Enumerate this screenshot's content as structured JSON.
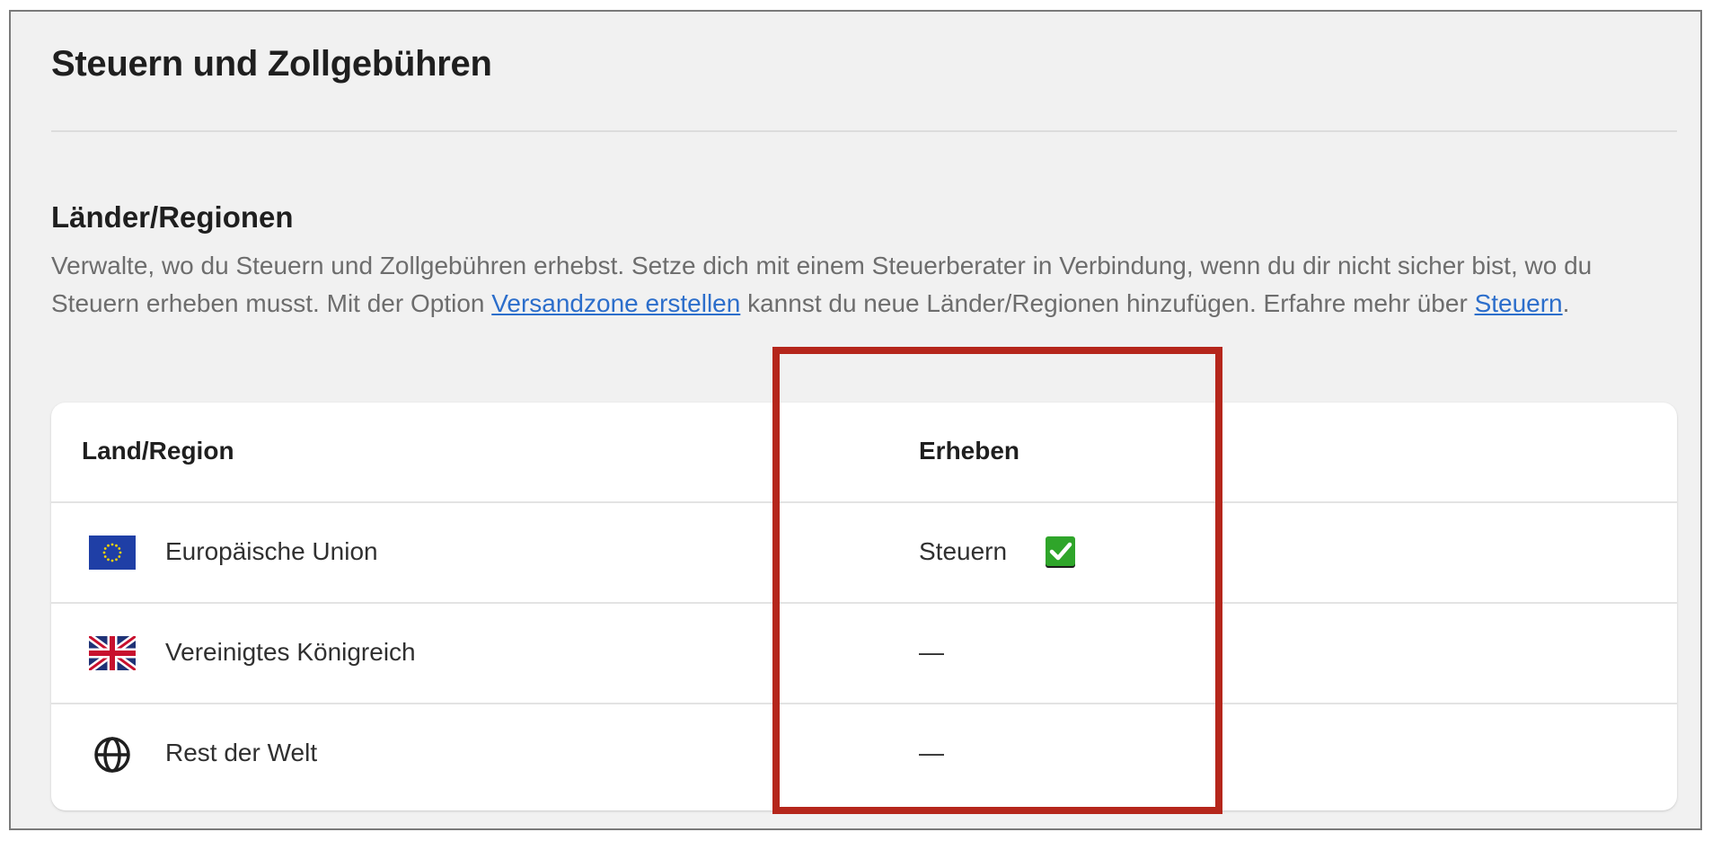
{
  "page": {
    "title": "Steuern und Zollgebühren"
  },
  "section": {
    "title": "Länder/Regionen",
    "description_part1": "Verwalte, wo du Steuern und Zollgebühren erhebst. Setze dich mit einem Steuerberater in Verbindung, wenn du dir nicht sicher bist, wo du Steuern erheben musst. Mit der Option ",
    "link_shipping_zone": "Versandzone erstellen",
    "description_part2": " kannst du neue Länder/Regionen hinzufügen. Erfahre mehr über ",
    "link_taxes": "Steuern",
    "description_end": "."
  },
  "table": {
    "headers": {
      "country": "Land/Region",
      "collect": "Erheben"
    },
    "rows": [
      {
        "icon": "eu-flag-icon",
        "name": "Europäische Union",
        "collect": "Steuern",
        "status_icon": "check-mark-icon"
      },
      {
        "icon": "uk-flag-icon",
        "name": "Vereinigtes Königreich",
        "collect": "—"
      },
      {
        "icon": "globe-icon",
        "name": "Rest der Welt",
        "collect": "—"
      }
    ]
  },
  "colors": {
    "link": "#2c6ecb",
    "highlight": "#b5261b",
    "check": "#2fa52a"
  }
}
